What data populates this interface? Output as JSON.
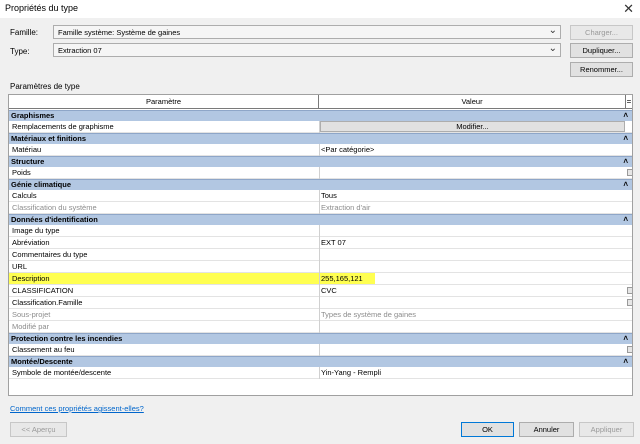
{
  "window": {
    "title": "Propriétés du type",
    "close_icon": "close-icon"
  },
  "family": {
    "label": "Famille:",
    "value": "Famille système: Système de gaines"
  },
  "type": {
    "label": "Type:",
    "value": "Extraction 07"
  },
  "buttons": {
    "load": "Charger...",
    "duplicate": "Dupliquer...",
    "rename": "Renommer...",
    "preview": "<< Aperçu",
    "ok": "OK",
    "cancel": "Annuler",
    "apply": "Appliquer"
  },
  "section_label": "Paramètres de type",
  "grid": {
    "col_param": "Paramètre",
    "col_value": "Valeur",
    "col_eq": "=",
    "groups": [
      {
        "name": "Graphismes",
        "rows": [
          {
            "param": "Remplacements de graphisme",
            "value": "Modifier...",
            "button": true
          }
        ]
      },
      {
        "name": "Matériaux et finitions",
        "rows": [
          {
            "param": "Matériau",
            "value": "<Par catégorie>"
          }
        ]
      },
      {
        "name": "Structure",
        "rows": [
          {
            "param": "Poids",
            "value": "",
            "check": true
          }
        ]
      },
      {
        "name": "Génie climatique",
        "rows": [
          {
            "param": "Calculs",
            "value": "Tous"
          },
          {
            "param": "Classification du système",
            "value": "Extraction d'air",
            "dim": true
          }
        ]
      },
      {
        "name": "Données d'identification",
        "rows": [
          {
            "param": "Image du type",
            "value": ""
          },
          {
            "param": "Abréviation",
            "value": "EXT 07"
          },
          {
            "param": "Commentaires du type",
            "value": ""
          },
          {
            "param": "URL",
            "value": ""
          },
          {
            "param": "Description",
            "value": "255,165,121",
            "highlight": true
          },
          {
            "param": "CLASSIFICATION",
            "value": "CVC",
            "check": true
          },
          {
            "param": "Classification.Famille",
            "value": "",
            "check": true
          },
          {
            "param": "Sous-projet",
            "value": "Types de système de gaines",
            "dim": true
          },
          {
            "param": "Modifié par",
            "value": "",
            "dim": true
          }
        ]
      },
      {
        "name": "Protection contre les incendies",
        "rows": [
          {
            "param": "Classement au feu",
            "value": "",
            "check": true
          }
        ]
      },
      {
        "name": "Montée/Descente",
        "rows": [
          {
            "param": "Symbole de montée/descente",
            "value": "Yin-Yang - Rempli"
          }
        ]
      }
    ]
  },
  "help_link": "Comment ces propriétés agissent-elles?",
  "colors": {
    "group_header": "#b2c7e2",
    "highlight": "#ffff33",
    "link": "#0066cc",
    "ok_border": "#0078d7"
  }
}
